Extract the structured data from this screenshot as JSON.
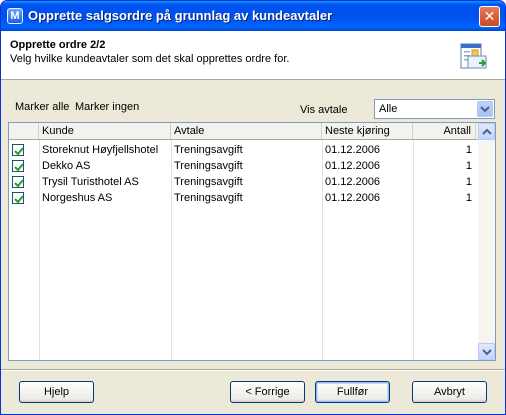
{
  "window": {
    "title": "Opprette salgsordre på grunnlag av kundeavtaler",
    "app_icon_letter": "M",
    "close_symbol": "✕"
  },
  "header": {
    "title": "Opprette ordre 2/2",
    "subtitle": "Velg hvilke kundeavtaler som det skal opprettes ordre for."
  },
  "toolbar": {
    "select_all": "Marker alle",
    "select_none": "Marker ingen",
    "filter_label": "Vis avtale",
    "filter_value": "Alle"
  },
  "grid": {
    "columns": [
      "Kunde",
      "Avtale",
      "Neste kjøring",
      "Antall"
    ],
    "rows": [
      {
        "checked": true,
        "kunde": "Storeknut Høyfjellshotel",
        "avtale": "Treningsavgift",
        "neste": "01.12.2006",
        "antall": "1"
      },
      {
        "checked": true,
        "kunde": "Dekko AS",
        "avtale": "Treningsavgift",
        "neste": "01.12.2006",
        "antall": "1"
      },
      {
        "checked": true,
        "kunde": "Trysil Turisthotel AS",
        "avtale": "Treningsavgift",
        "neste": "01.12.2006",
        "antall": "1"
      },
      {
        "checked": true,
        "kunde": "Norgeshus AS",
        "avtale": "Treningsavgift",
        "neste": "01.12.2006",
        "antall": "1"
      }
    ]
  },
  "footer": {
    "help": "Hjelp",
    "back": "< Forrige",
    "finish": "Fullfør",
    "cancel": "Avbryt"
  },
  "icons": {
    "app": "app-icon",
    "wizard": "document-wizard-icon",
    "checkbox_check": "checkmark-icon",
    "combo": "chevron-down-icon",
    "scroll_up": "chevron-up-icon",
    "scroll_down": "chevron-down-icon"
  },
  "colors": {
    "titlebar": "#0053EE",
    "window_bg": "#ECE9D8",
    "check_green": "#21A121"
  }
}
